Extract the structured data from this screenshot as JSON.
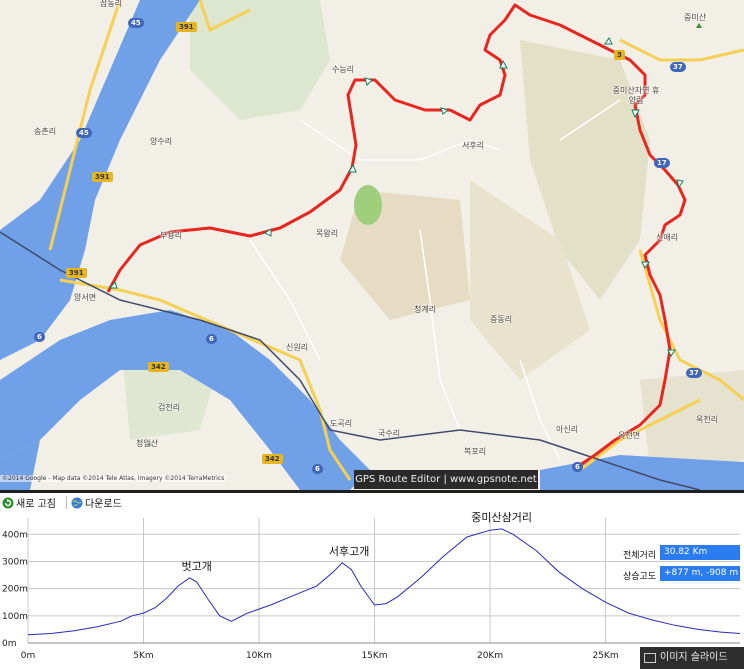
{
  "map": {
    "places": [
      {
        "id": "samdong",
        "text": "삼동리"
      },
      {
        "id": "sueung",
        "text": "수능리"
      },
      {
        "id": "songchon",
        "text": "송촌리"
      },
      {
        "id": "yangsu",
        "text": "양수리"
      },
      {
        "id": "seohu",
        "text": "서후리"
      },
      {
        "id": "jungmisan",
        "text": "중미산"
      },
      {
        "id": "resort",
        "text": "중미산자연 휴양림"
      },
      {
        "id": "sinae",
        "text": "신애리"
      },
      {
        "id": "mokwang",
        "text": "목왕리"
      },
      {
        "id": "buyong",
        "text": "부용리"
      },
      {
        "id": "yangseo",
        "text": "양서면"
      },
      {
        "id": "cheonggye",
        "text": "청계리"
      },
      {
        "id": "jeungdong",
        "text": "증동리"
      },
      {
        "id": "sinwon",
        "text": "신원리"
      },
      {
        "id": "okcheon",
        "text": "옥천리"
      },
      {
        "id": "okcheonmyeon",
        "text": "옥천면"
      },
      {
        "id": "asin",
        "text": "아신리"
      },
      {
        "id": "geomcheon",
        "text": "검천리"
      },
      {
        "id": "cheongam",
        "text": "청암산"
      },
      {
        "id": "dogok",
        "text": "도곡리"
      },
      {
        "id": "guksu",
        "text": "국수리"
      },
      {
        "id": "bokpo",
        "text": "복포리"
      }
    ],
    "shields": [
      {
        "id": "r45a",
        "text": "45",
        "style": "blue"
      },
      {
        "id": "r391a",
        "text": "391",
        "style": "yellow"
      },
      {
        "id": "r45b",
        "text": "45",
        "style": "blue"
      },
      {
        "id": "r391b",
        "text": "391",
        "style": "yellow"
      },
      {
        "id": "r391c",
        "text": "391",
        "style": "yellow"
      },
      {
        "id": "r37a",
        "text": "37",
        "style": "blue"
      },
      {
        "id": "r37b",
        "text": "37",
        "style": "blue"
      },
      {
        "id": "r6a",
        "text": "6",
        "style": "blue"
      },
      {
        "id": "r6b",
        "text": "6",
        "style": "blue"
      },
      {
        "id": "r6c",
        "text": "6",
        "style": "blue"
      },
      {
        "id": "r6d",
        "text": "6",
        "style": "blue"
      },
      {
        "id": "r342a",
        "text": "342",
        "style": "yellow"
      },
      {
        "id": "r342b",
        "text": "342",
        "style": "yellow"
      },
      {
        "id": "r17",
        "text": "17",
        "style": "blue"
      },
      {
        "id": "r3xx",
        "text": "3",
        "style": "yellow"
      }
    ],
    "copyright": "©2014 Google - Map data ©2014 Tele Atlas, Imagery ©2014 TerraMetrics",
    "banner": "GPS Route Editor | www.gpsnote.net"
  },
  "toolbar": {
    "refresh_label": "새로 고침",
    "download_label": "다운로드"
  },
  "chart_data": {
    "type": "area",
    "title": "",
    "xlabel": "",
    "ylabel": "",
    "x_ticks": [
      "0m",
      "5Km",
      "10Km",
      "15Km",
      "20Km",
      "25Km"
    ],
    "y_ticks": [
      "0m",
      "100m",
      "200m",
      "300m",
      "400m"
    ],
    "xlim": [
      0,
      30.82
    ],
    "ylim": [
      0,
      460
    ],
    "x": [
      0,
      1,
      2,
      3,
      4,
      4.5,
      5,
      5.5,
      6,
      6.5,
      7,
      7.3,
      7.8,
      8.3,
      8.8,
      9.5,
      10.5,
      11.5,
      12.5,
      13.2,
      13.6,
      14.0,
      14.4,
      15.0,
      15.5,
      16.0,
      17,
      18,
      19,
      20,
      20.5,
      21,
      22,
      23,
      24,
      25,
      26,
      27,
      28,
      29,
      30,
      30.82
    ],
    "y": [
      30,
      35,
      45,
      60,
      80,
      100,
      110,
      130,
      165,
      210,
      240,
      225,
      160,
      100,
      80,
      110,
      140,
      175,
      210,
      260,
      295,
      270,
      210,
      140,
      145,
      170,
      240,
      320,
      390,
      415,
      420,
      400,
      340,
      260,
      200,
      150,
      110,
      85,
      65,
      50,
      40,
      35
    ],
    "series_color": "#2a2ab8",
    "annotations": [
      {
        "text": "벗고개",
        "x": 7.3,
        "y": 240
      },
      {
        "text": "서후고개",
        "x": 13.9,
        "y": 295
      },
      {
        "text": "중미산삼거리",
        "x": 20.5,
        "y": 420
      }
    ]
  },
  "info": {
    "distance_label": "전체거리",
    "distance_value": "30.82 Km",
    "elevation_label": "상승고도",
    "elevation_value": "+877 m, -908 m"
  },
  "slideshow_label": "이미지 슬라이드"
}
